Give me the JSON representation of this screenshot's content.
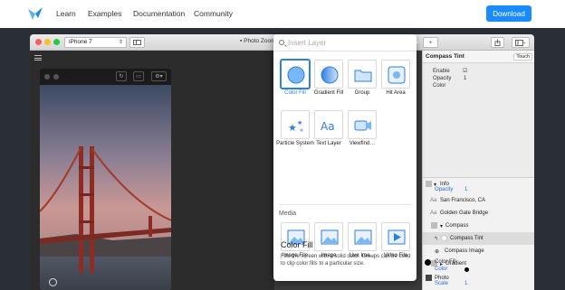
{
  "nav": {
    "links": [
      "Learn",
      "Examples",
      "Documentation",
      "Community"
    ],
    "download": "Download"
  },
  "toolbar": {
    "device": "iPhone 7",
    "doc_title": "Photo Zoom"
  },
  "popover": {
    "search_placeholder": "Insert Layer",
    "items": [
      {
        "label": "Color Fill",
        "icon": "color-fill-icon",
        "selected": true
      },
      {
        "label": "Gradient Fill",
        "icon": "gradient-fill-icon"
      },
      {
        "label": "Group",
        "icon": "folder-icon"
      },
      {
        "label": "Hit Area",
        "icon": "hit-area-icon"
      },
      {
        "label": "Particle System",
        "icon": "particle-system-icon"
      },
      {
        "label": "Text Layer",
        "icon": "text-layer-icon"
      },
      {
        "label": "Viewfind…",
        "icon": "viewfinder-icon"
      }
    ],
    "media_section": "Media",
    "media_items": [
      {
        "label": "Image File",
        "icon": "image-file-icon"
      },
      {
        "label": "Image",
        "icon": "image-icon"
      },
      {
        "label": "Live Ima…",
        "icon": "live-image-icon"
      },
      {
        "label": "Video File",
        "icon": "video-file-icon"
      }
    ],
    "desc_title": "Color Fill",
    "desc_text": "Fills the screen with a solid color. Groups can be used to clip color fills to a particular size."
  },
  "inspector": {
    "title": "Compass Tint",
    "touch": "Touch",
    "props": [
      {
        "label": "Enable",
        "value": "☑"
      },
      {
        "label": "Opacity",
        "value": "1"
      },
      {
        "label": "Color",
        "value": ""
      }
    ]
  },
  "layers": [
    {
      "label": "Info",
      "sub_label": "Opacity",
      "sub_value": "1"
    },
    {
      "label": "San Francisco, CA"
    },
    {
      "label": "Golden Gate Bridge"
    },
    {
      "label": "Compass"
    },
    {
      "label": "Compass Tint"
    },
    {
      "label": "Compass Image"
    },
    {
      "label": "Gradient"
    },
    {
      "label": "Photo",
      "sub_label": "Scale",
      "sub_value": "1"
    },
    {
      "label": "Color Fill",
      "sub_label": "Color"
    }
  ],
  "colors": {
    "accent": "#1a8cff",
    "selection": "#2f7fe0",
    "window_dark": "#2c2c2c"
  }
}
